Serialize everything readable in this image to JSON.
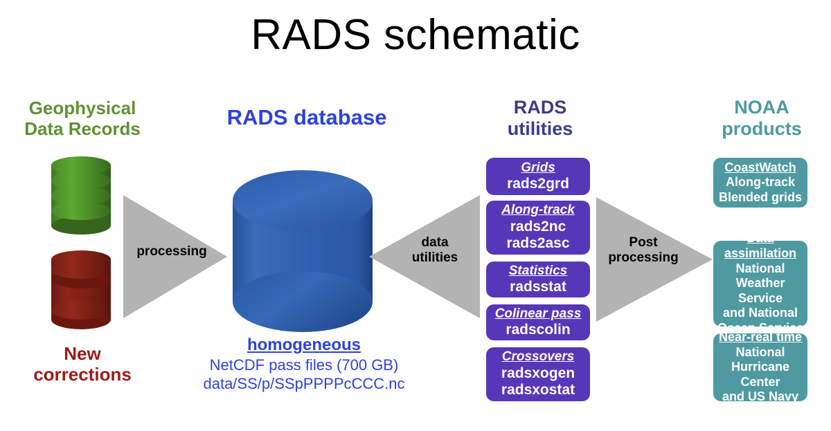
{
  "title": "RADS schematic",
  "columns": {
    "gdr": {
      "heading_line1": "Geophysical",
      "heading_line2": "Data Records",
      "heading_color": "#5E9132",
      "cylinder_icon": "green-database-cylinder-icon",
      "corrections_line1": "New",
      "corrections_line2": "corrections",
      "corrections_color": "#9E1B17",
      "corrections_icon": "red-database-cylinder-icon"
    },
    "database": {
      "heading_strong": "RADS",
      "heading_rest": "database",
      "heading_color": "#2D42DE",
      "cylinder_icon": "blue-database-cylinder-icon",
      "caption_title": "homogeneous",
      "caption_line2": "NetCDF pass files (700 GB)",
      "caption_line3": "data/SS/p/SSpPPPPcCCC.nc"
    },
    "utilities": {
      "heading_line1": "RADS",
      "heading_line2": "utilities",
      "heading_color": "#3C3C8C",
      "box_color": "#5637B8",
      "boxes": [
        {
          "title": "Grids",
          "lines": [
            "rads2grd"
          ]
        },
        {
          "title": "Along-track",
          "lines": [
            "rads2nc",
            "rads2asc"
          ]
        },
        {
          "title": "Statistics",
          "lines": [
            "radsstat"
          ]
        },
        {
          "title": "Colinear pass",
          "lines": [
            "radscolin"
          ]
        },
        {
          "title": "Crossovers",
          "lines": [
            "radsxogen",
            "radsxostat"
          ]
        }
      ]
    },
    "noaa": {
      "heading_line1": "NOAA",
      "heading_line2": "products",
      "heading_color": "#4D9AA1",
      "box_color": "#4F9AA1",
      "boxes": [
        {
          "title": "CoastWatch",
          "lines": [
            "Along-track",
            "Blended grids"
          ]
        },
        {
          "title": "Data assimilation",
          "lines": [
            "National",
            "Weather Service",
            "and National",
            "Ocean Service"
          ]
        },
        {
          "title": "Near-real time",
          "lines": [
            "National",
            "Hurricane Center",
            "and US Navy"
          ]
        }
      ]
    }
  },
  "arrows": {
    "color": "#B3B3B3",
    "processing": {
      "label_line1": "processing",
      "label_line2": "",
      "direction": "right"
    },
    "data_utilities": {
      "label_line1": "data",
      "label_line2": "utilities",
      "direction": "left"
    },
    "post_processing": {
      "label_line1": "Post",
      "label_line2": "processing",
      "direction": "right"
    }
  },
  "chart_data": {
    "type": "diagram",
    "title": "RADS schematic",
    "flow": [
      {
        "from": "Geophysical Data Records / New corrections",
        "via": "processing",
        "to": "RADS database"
      },
      {
        "from": "RADS database",
        "via": "data utilities",
        "to": "RADS utilities"
      },
      {
        "from": "RADS utilities",
        "via": "Post processing",
        "to": "NOAA products"
      }
    ]
  }
}
